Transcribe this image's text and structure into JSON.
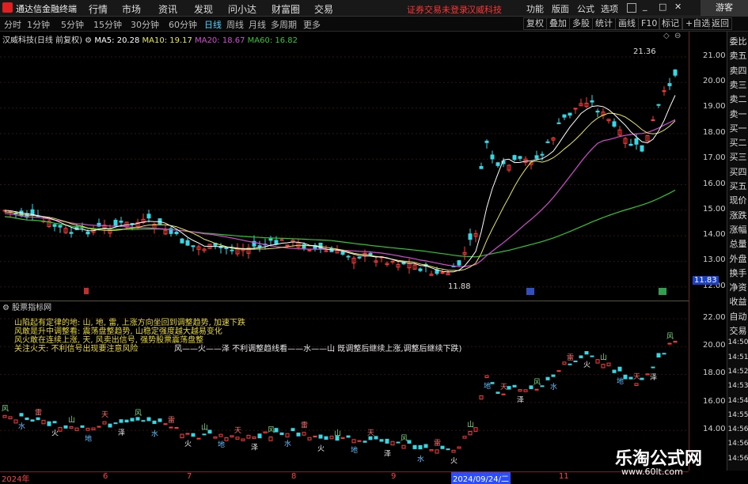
{
  "titlebar": {
    "app_name": "通达信金融终端",
    "menus": [
      "行情",
      "市场",
      "资讯",
      "发现",
      "问小达",
      "财富圈",
      "交易"
    ],
    "notice": "证券交易未登录",
    "stock_tab": "汉威科技",
    "right_menus": [
      "功能",
      "版面",
      "公式",
      "选项"
    ],
    "guest": "游客"
  },
  "periods": {
    "items": [
      "分时",
      "1分钟",
      "5分钟",
      "15分钟",
      "30分钟",
      "60分钟",
      "日线",
      "周线",
      "月线",
      "多周期",
      "更多"
    ],
    "active": "日线"
  },
  "toolbar_right": [
    "复权",
    "叠加",
    "多股",
    "统计",
    "画线",
    "F10",
    "标记",
    "+自选",
    "返回"
  ],
  "main_info": {
    "name": "汉威科技(日线 前复权)",
    "ma5": "MA5: 20.28",
    "ma10": "MA10: 19.17",
    "ma20": "MA20: 18.67",
    "ma60": "MA60: 16.82",
    "high_label": "21.36",
    "low_label": "11.88",
    "current_price": "11.83"
  },
  "sub_info": {
    "name": "股票指标网",
    "line1": "风——火——泽   不利调整趋线看——水——山   既调整后继续上涨,调整后继续下跌)"
  },
  "notes": [
    "山陷起有定律的地: 山, 地, 雷,  上涨方向坐回到调整趋势, 加速下跌",
    "风敢是升中调整看: 震荡盘整趋势,  山稳定强度越大越易变化",
    "风火敢在连续上涨, 天, 风卖出信号, 强势股票震荡盘整",
    "关注火天: 不利信号出现要注意风险"
  ],
  "axis_main": [
    "21.00",
    "20.00",
    "19.00",
    "18.00",
    "17.00",
    "16.00",
    "15.00",
    "14.00",
    "13.00",
    "12.00"
  ],
  "axis_sub": [
    "22.00",
    "20.00",
    "18.00",
    "16.00",
    "14.00"
  ],
  "side_panel": [
    "委比",
    "卖五",
    "卖四",
    "卖三",
    "卖二",
    "卖一",
    "买一",
    "买二",
    "买三",
    "买四",
    "买五",
    "现价",
    "涨跌",
    "涨幅",
    "总量",
    "外盘",
    "换手",
    "净资",
    "收益",
    "自动",
    "交易",
    "14:50",
    "14:51",
    "14:52",
    "14:53",
    "14:54",
    "14:55",
    "14:56",
    "14:56",
    "14:56"
  ],
  "bottom_axis": {
    "labels": [
      "2024年",
      "6",
      "7",
      "8",
      "9",
      "2024/09/24/二",
      "11"
    ]
  },
  "watermark": {
    "title": "乐淘公式网",
    "url": "www.60lt.com"
  },
  "colors": {
    "up": "#ff3b3b",
    "down": "#36d8e6",
    "ma5": "#ffffff",
    "ma10": "#e8e850",
    "ma20": "#d34ad3",
    "ma60": "#2ec82e",
    "notice": "#ff3333",
    "active_tab": "#4fd4ff"
  }
}
